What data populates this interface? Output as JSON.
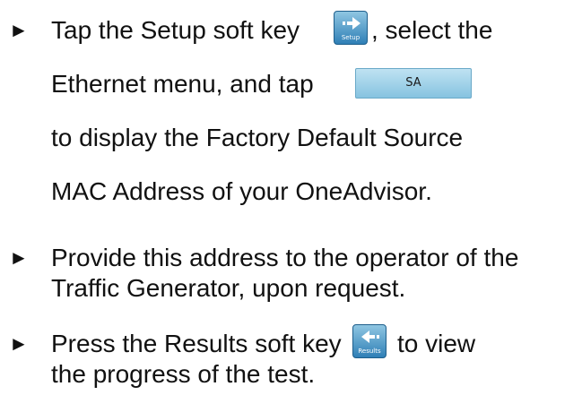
{
  "bullet_glyph": "►",
  "steps": [
    {
      "lines": [
        {
          "before": "Tap the Setup soft key",
          "after": ", select the"
        },
        {
          "before": "Ethernet menu, and tap"
        },
        {
          "text": "to display the Factory Default Source"
        },
        {
          "text": "MAC Address of your OneAdvisor."
        }
      ],
      "setup_key_label": "Setup",
      "sa_button_label": "SA"
    },
    {
      "lines": [
        {
          "text": "Provide this address to the operator of the"
        },
        {
          "text": "Traffic Generator, upon request."
        }
      ]
    },
    {
      "lines": [
        {
          "before": "Press the Results soft key",
          "after": "to view"
        },
        {
          "text": "the progress of the test."
        }
      ],
      "results_key_label": "Results"
    }
  ],
  "icons": {
    "setup_key": "arrow-right-icon",
    "results_key": "arrow-left-icon"
  },
  "colors": {
    "softkey_top": "#8fc6e2",
    "softkey_bottom": "#2f7fb6",
    "sa_button": "#a3d3ea"
  }
}
